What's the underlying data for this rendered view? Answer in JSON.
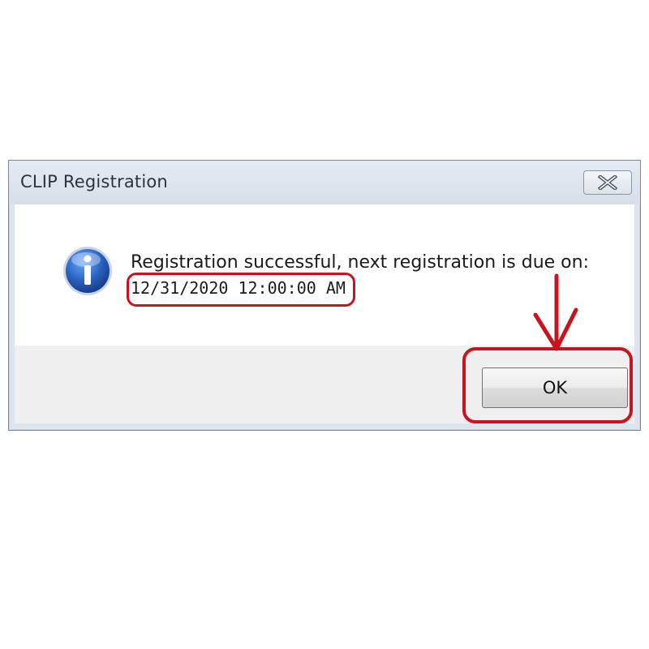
{
  "dialog": {
    "title": "CLIP Registration",
    "close_icon": "close-x-icon",
    "info_icon": "information-icon",
    "message_line1": "Registration successful, next registration is due on:",
    "message_line2": "12/31/2020 12:00:00 AM",
    "ok_label": "OK"
  },
  "annotations": {
    "highlight_color": "#c8141e",
    "arrow_icon": "down-arrow-icon"
  },
  "colors": {
    "titlebar": "#dce4ee",
    "content_bg": "#ffffff",
    "footer_bg": "#f0f0f0",
    "info_icon_blue": "#2a62c0"
  }
}
